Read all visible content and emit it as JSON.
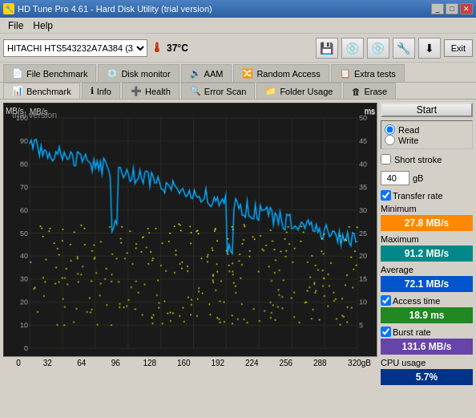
{
  "titlebar": {
    "title": "HD Tune Pro 4.61 - Hard Disk Utility (trial version)",
    "controls": [
      "minimize",
      "maximize",
      "close"
    ]
  },
  "menubar": {
    "items": [
      "File",
      "Help"
    ]
  },
  "toolbar": {
    "drive": "HITACHI HTS543232A7A384 (320 gB)",
    "temperature": "37°C",
    "exit_label": "Exit"
  },
  "tabs_top": [
    {
      "label": "File Benchmark",
      "icon": "📄",
      "active": false
    },
    {
      "label": "Disk monitor",
      "icon": "💿",
      "active": false
    },
    {
      "label": "AAM",
      "icon": "🔊",
      "active": false
    },
    {
      "label": "Random Access",
      "icon": "🔀",
      "active": false
    },
    {
      "label": "Extra tests",
      "icon": "📋",
      "active": false
    }
  ],
  "tabs_bottom": [
    {
      "label": "Benchmark",
      "icon": "📊",
      "active": true
    },
    {
      "label": "Info",
      "icon": "ℹ",
      "active": false
    },
    {
      "label": "Health",
      "icon": "➕",
      "active": false
    },
    {
      "label": "Error Scan",
      "icon": "🔍",
      "active": false
    },
    {
      "label": "Folder Usage",
      "icon": "📁",
      "active": false
    },
    {
      "label": "Erase",
      "icon": "🗑",
      "active": false
    }
  ],
  "chart": {
    "y_label_left": "MB/s",
    "y_label_right": "ms",
    "watermark": "trial version",
    "y_max": 100,
    "y_min": 0,
    "y_right_max": 50,
    "x_labels": [
      "0",
      "32",
      "64",
      "96",
      "128",
      "160",
      "192",
      "224",
      "256",
      "288",
      "320gB"
    ],
    "y_ticks": [
      100,
      90,
      80,
      70,
      60,
      50,
      40,
      30,
      20,
      10
    ],
    "y_right_ticks": [
      50,
      45,
      40,
      35,
      30,
      25,
      20,
      15,
      10,
      5
    ]
  },
  "controls": {
    "start_label": "Start",
    "read_label": "Read",
    "write_label": "Write",
    "short_stroke_label": "Short stroke",
    "spinbox_value": "40",
    "spinbox_unit": "gB",
    "transfer_rate_label": "Transfer rate"
  },
  "stats": {
    "minimum_label": "Minimum",
    "minimum_value": "27.8 MB/s",
    "maximum_label": "Maximum",
    "maximum_value": "91.2 MB/s",
    "average_label": "Average",
    "average_value": "72.1 MB/s",
    "access_time_label": "Access time",
    "access_time_value": "18.9 ms",
    "burst_rate_label": "Burst rate",
    "burst_rate_value": "131.6 MB/s",
    "cpu_usage_label": "CPU usage",
    "cpu_usage_value": "5.7%"
  }
}
